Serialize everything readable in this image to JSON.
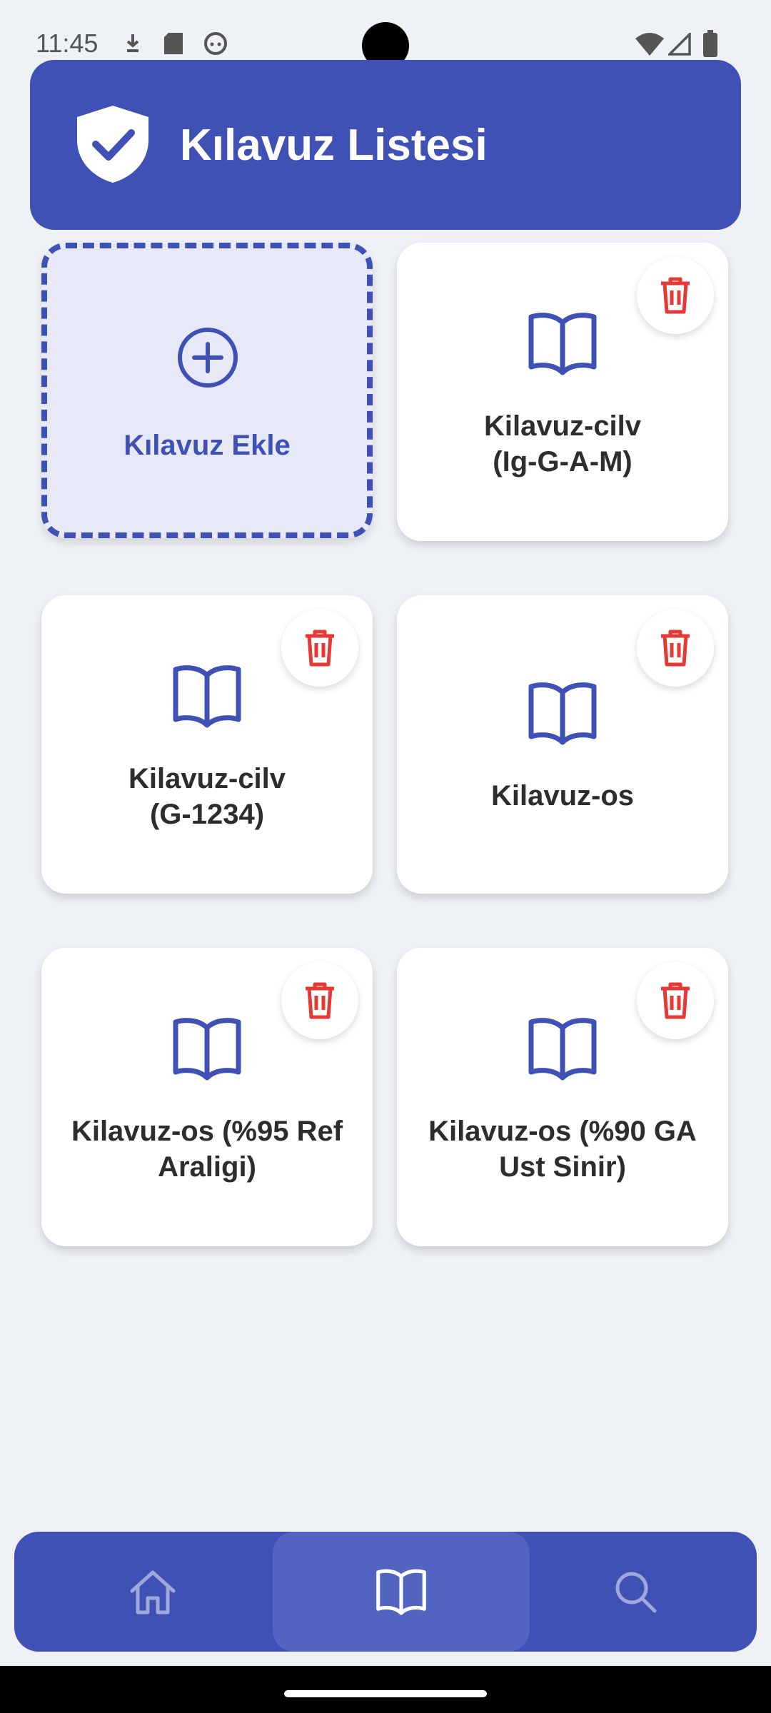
{
  "status_bar": {
    "time": "11:45"
  },
  "header": {
    "title": "Kılavuz Listesi"
  },
  "add_card": {
    "label": "Kılavuz Ekle"
  },
  "guides": [
    {
      "label_line1": "Kilavuz-cilv",
      "label_line2": "(Ig-G-A-M)"
    },
    {
      "label_line1": "Kilavuz-cilv",
      "label_line2": "(G-1234)"
    },
    {
      "label_line1": "Kilavuz-os",
      "label_line2": ""
    },
    {
      "label_line1": "Kilavuz-os (%95 Ref",
      "label_line2": "Araligi)"
    },
    {
      "label_line1": "Kilavuz-os (%90 GA",
      "label_line2": "Ust Sinir)"
    }
  ],
  "nav": {
    "items": [
      {
        "icon": "home-icon",
        "active": false
      },
      {
        "icon": "book-icon",
        "active": true
      },
      {
        "icon": "search-icon",
        "active": false
      }
    ]
  },
  "colors": {
    "primary": "#3f51b5",
    "delete": "#e53935",
    "background": "#eef1f6"
  }
}
